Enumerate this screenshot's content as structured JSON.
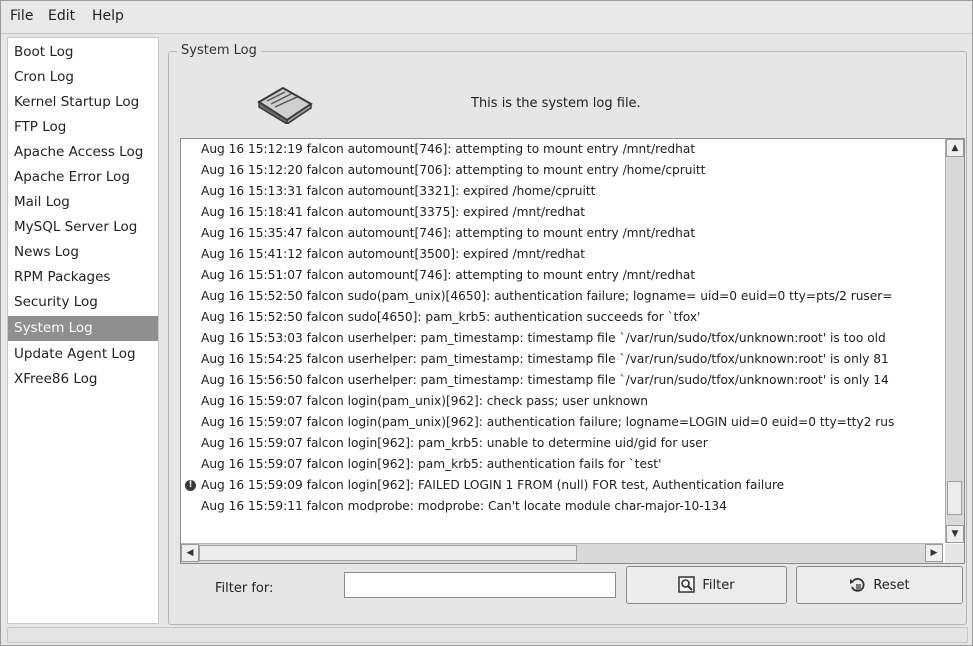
{
  "menu": {
    "file": "File",
    "edit": "Edit",
    "help": "Help"
  },
  "sidebar": {
    "items": [
      {
        "label": "Boot Log"
      },
      {
        "label": "Cron Log"
      },
      {
        "label": "Kernel Startup Log"
      },
      {
        "label": "FTP Log"
      },
      {
        "label": "Apache Access Log"
      },
      {
        "label": "Apache Error Log"
      },
      {
        "label": "Mail Log"
      },
      {
        "label": "MySQL Server Log"
      },
      {
        "label": "News Log"
      },
      {
        "label": "RPM Packages"
      },
      {
        "label": "Security Log"
      },
      {
        "label": "System Log"
      },
      {
        "label": "Update Agent Log"
      },
      {
        "label": "XFree86 Log"
      }
    ],
    "selected": "System Log"
  },
  "main": {
    "frame_title": "System Log",
    "header_text": "This is the system log file.",
    "log_lines": [
      "Aug 16 15:12:19 falcon automount[746]: attempting to mount entry /mnt/redhat",
      "Aug 16 15:12:20 falcon automount[706]: attempting to mount entry /home/cpruitt",
      "Aug 16 15:13:31 falcon automount[3321]: expired /home/cpruitt",
      "Aug 16 15:18:41 falcon automount[3375]: expired /mnt/redhat",
      "Aug 16 15:35:47 falcon automount[746]: attempting to mount entry /mnt/redhat",
      "Aug 16 15:41:12 falcon automount[3500]: expired /mnt/redhat",
      "Aug 16 15:51:07 falcon automount[746]: attempting to mount entry /mnt/redhat",
      "Aug 16 15:52:50 falcon sudo(pam_unix)[4650]: authentication failure; logname= uid=0 euid=0 tty=pts/2 ruser=",
      "Aug 16 15:52:50 falcon sudo[4650]: pam_krb5: authentication succeeds for `tfox'",
      "Aug 16 15:53:03 falcon userhelper: pam_timestamp: timestamp file `/var/run/sudo/tfox/unknown:root' is too old",
      "Aug 16 15:54:25 falcon userhelper: pam_timestamp: timestamp file `/var/run/sudo/tfox/unknown:root' is only 81",
      "Aug 16 15:56:50 falcon userhelper: pam_timestamp: timestamp file `/var/run/sudo/tfox/unknown:root' is only 14",
      "Aug 16 15:59:07 falcon login(pam_unix)[962]: check pass; user unknown",
      "Aug 16 15:59:07 falcon login(pam_unix)[962]: authentication failure; logname=LOGIN uid=0 euid=0 tty=tty2 rus",
      "Aug 16 15:59:07 falcon login[962]: pam_krb5: unable to determine uid/gid for user",
      "Aug 16 15:59:07 falcon login[962]: pam_krb5: authentication fails for `test'",
      "Aug 16 15:59:09 falcon login[962]: FAILED LOGIN 1 FROM (null) FOR test, Authentication failure",
      "Aug 16 15:59:11 falcon modprobe: modprobe: Can't locate module char-major-10-134"
    ],
    "warning_line_index": 16
  },
  "filter": {
    "label": "Filter for:",
    "value": "",
    "filter_button": "Filter",
    "reset_button": "Reset"
  }
}
